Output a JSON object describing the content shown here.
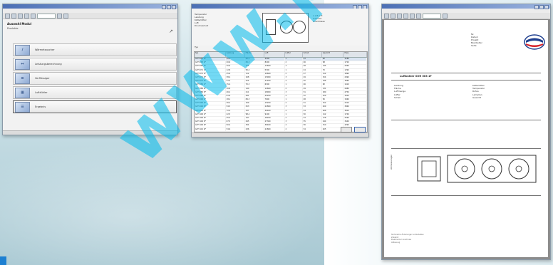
{
  "win1": {
    "panel_title": "Auswahl Modul",
    "panel_sub": "Produkte",
    "items": [
      {
        "label": "Wärmetauscher"
      },
      {
        "label": "Leistungsberechnung"
      },
      {
        "label": "Verflüssiger"
      },
      {
        "label": "Luftkühler"
      },
      {
        "label": "Ergebnis"
      }
    ]
  },
  "win2": {
    "params": [
      "Temperatur",
      "Leistung",
      "Kältemittel",
      "Luft",
      "Druckverlust"
    ],
    "note": [
      "L x B x H",
      "Gewicht",
      "Anschlüsse"
    ],
    "table_label": "Typ",
    "columns": [
      "Typ",
      "Leistung",
      "Fläche",
      "Luft",
      "Lüfter",
      "Schall",
      "Gewicht",
      "Preis"
    ],
    "rows": [
      [
        "GVH 063 1F",
        "10,3",
        "42,1",
        "4200",
        "1",
        "43",
        "62",
        "1180"
      ],
      [
        "GVH 063 2F",
        "20,6",
        "84,3",
        "8400",
        "2",
        "46",
        "98",
        "1720"
      ],
      [
        "GVH 063 3F",
        "30,9",
        "126",
        "12600",
        "3",
        "48",
        "135",
        "2260"
      ],
      [
        "GVH 071 1F",
        "12,8",
        "56,2",
        "5300",
        "1",
        "44",
        "70",
        "1290"
      ],
      [
        "GVH 071 2F",
        "25,6",
        "112",
        "10600",
        "2",
        "47",
        "112",
        "1890"
      ],
      [
        "GVH 071 3F",
        "38,4",
        "168",
        "15900",
        "3",
        "49",
        "154",
        "2490"
      ],
      [
        "GVH 071 4F",
        "51,2",
        "224",
        "21200",
        "4",
        "50",
        "196",
        "3090"
      ],
      [
        "GVH 080 1F",
        "15,4",
        "70,3",
        "6300",
        "1",
        "46",
        "82",
        "1410"
      ],
      [
        "GVH 080 2F",
        "30,8",
        "140",
        "12600",
        "2",
        "49",
        "131",
        "2080"
      ],
      [
        "GVH 080 3F",
        "46,2",
        "211",
        "18900",
        "3",
        "51",
        "180",
        "2750"
      ],
      [
        "GVH 080 4F",
        "61,6",
        "281",
        "25200",
        "4",
        "52",
        "229",
        "3420"
      ],
      [
        "GVH 090 1F",
        "18,1",
        "84,3",
        "7600",
        "1",
        "48",
        "95",
        "1560"
      ],
      [
        "GVH 090 2F",
        "36,2",
        "169",
        "15200",
        "2",
        "51",
        "152",
        "2310"
      ],
      [
        "GVH 090 3F",
        "54,3",
        "253",
        "22800",
        "3",
        "53",
        "209",
        "3060"
      ],
      [
        "GVH 090 4F",
        "72,4",
        "337",
        "30400",
        "4",
        "54",
        "266",
        "3810"
      ],
      [
        "GVH 100 1F",
        "22,5",
        "98,4",
        "9100",
        "1",
        "50",
        "112",
        "1740"
      ],
      [
        "GVH 100 2F",
        "45,0",
        "197",
        "18200",
        "2",
        "53",
        "178",
        "2590"
      ],
      [
        "GVH 100 3F",
        "67,5",
        "295",
        "27300",
        "3",
        "55",
        "244",
        "3440"
      ],
      [
        "GVH 100 4F",
        "90,0",
        "394",
        "36400",
        "4",
        "56",
        "310",
        "4290"
      ],
      [
        "GVH 112 2F",
        "54,6",
        "236",
        "21800",
        "2",
        "54",
        "205",
        "2930"
      ],
      [
        "GVH 112 3F",
        "81,9",
        "354",
        "32700",
        "3",
        "56",
        "281",
        "3890"
      ],
      [
        "GVH 112 4F",
        "109",
        "472",
        "43600",
        "4",
        "57",
        "357",
        "4850"
      ],
      [
        "GVH 125 3F",
        "96,4",
        "421",
        "38500",
        "3",
        "57",
        "326",
        "4420"
      ],
      [
        "GVH 125 4F",
        "128",
        "561",
        "51300",
        "4",
        "58",
        "414",
        "5510"
      ]
    ],
    "selected_row": 0
  },
  "win3": {
    "header": [
      "Nr.",
      "Datum",
      "Projekt",
      "Bearbeiter",
      "Seite"
    ],
    "title": "Luftkühler GVH 063 1F",
    "specs_left": [
      "Leistung",
      "Fläche",
      "Luftmenge",
      "Lüfter",
      "Schall"
    ],
    "specs_right": [
      "Kältemittel",
      "Temperatur",
      "Rohre",
      "Lamellen",
      "Gewicht"
    ],
    "vert_label": "Abmessungen",
    "notes": [
      "Technische Änderungen vorbehalten",
      "Zubehör",
      "Elektrischer Anschluss",
      "Abtauung"
    ]
  },
  "colors": {
    "accent": "#1c7fd1",
    "watermark": "#00b9eb",
    "titlebar": "#4a6fb5"
  },
  "watermark_text": "www.photo"
}
